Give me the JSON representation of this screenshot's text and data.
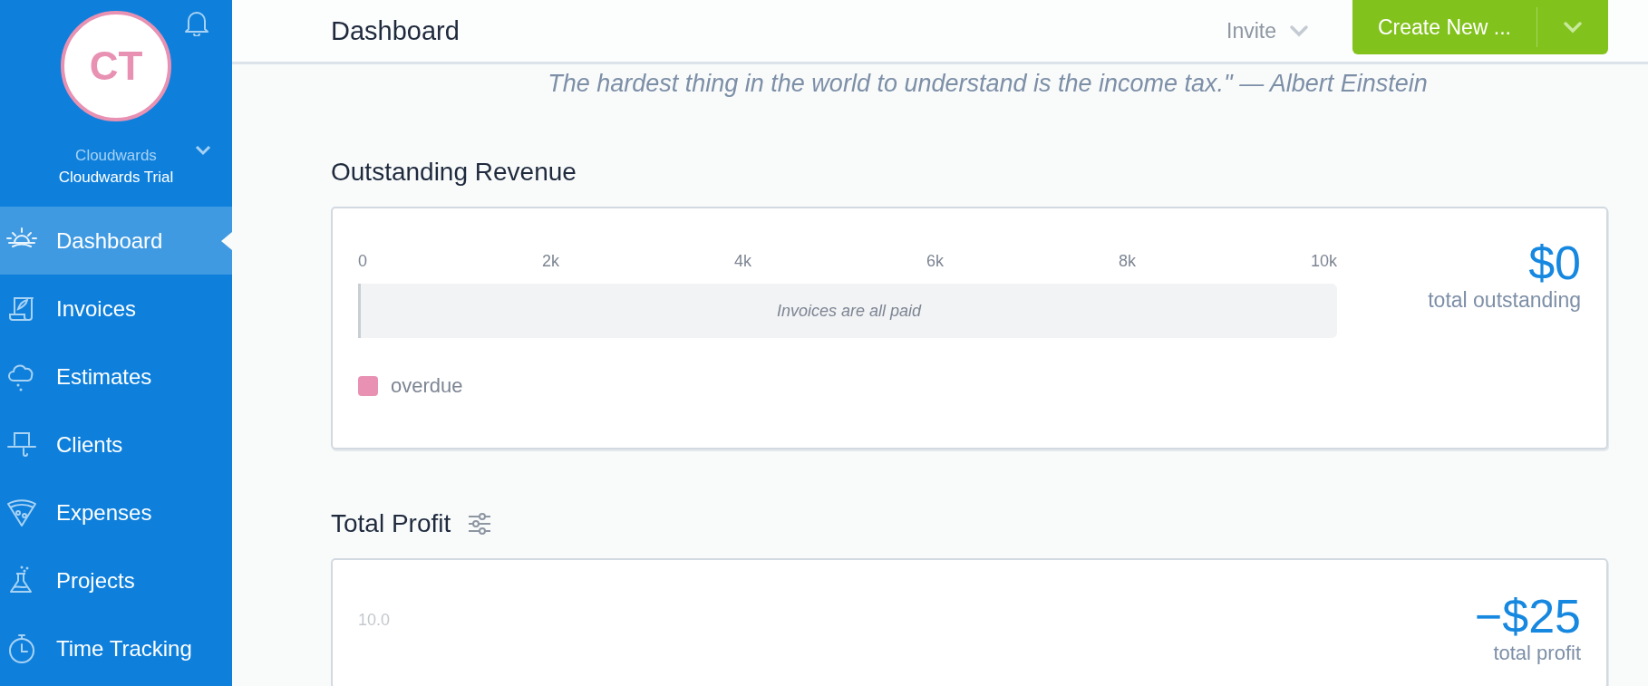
{
  "sidebar": {
    "avatar": {
      "initials": "CT"
    },
    "account": {
      "company": "Cloudwards",
      "name": "Cloudwards Trial"
    },
    "items": [
      {
        "label": "Dashboard",
        "selected": true
      },
      {
        "label": "Invoices",
        "selected": false
      },
      {
        "label": "Estimates",
        "selected": false
      },
      {
        "label": "Clients",
        "selected": false
      },
      {
        "label": "Expenses",
        "selected": false
      },
      {
        "label": "Projects",
        "selected": false
      },
      {
        "label": "Time Tracking",
        "selected": false
      }
    ]
  },
  "header": {
    "title": "Dashboard",
    "invite": "Invite",
    "create_button": "Create New ..."
  },
  "quote": "The hardest thing in the world to understand is the income tax.\"  — Albert Einstein",
  "outstanding_revenue": {
    "title": "Outstanding Revenue",
    "scale": [
      "0",
      "2k",
      "4k",
      "6k",
      "8k",
      "10k"
    ],
    "bar_message": "Invoices are all paid",
    "legend": [
      {
        "label": "overdue",
        "color": "#e891b2"
      }
    ],
    "total": "$0",
    "total_label": "total outstanding"
  },
  "total_profit": {
    "title": "Total Profit",
    "axis_label": "10.0",
    "total": "−$25",
    "total_label": "total profit"
  }
}
